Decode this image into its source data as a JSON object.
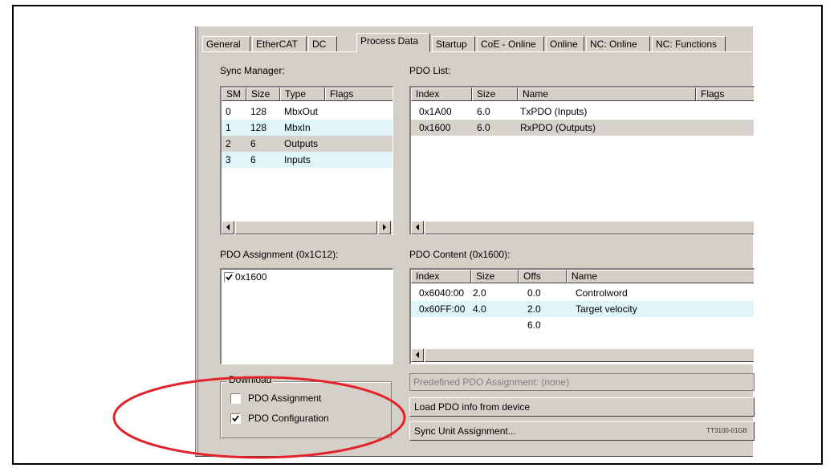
{
  "tabs": [
    "General",
    "EtherCAT",
    "DC",
    "Process Data",
    "Startup",
    "CoE - Online",
    "Online",
    "NC: Online",
    "NC: Functions"
  ],
  "active_tab": "Process Data",
  "sync_manager": {
    "label": "Sync Manager:",
    "columns": [
      "SM",
      "Size",
      "Type",
      "Flags"
    ],
    "rows": [
      {
        "sm": "0",
        "size": "128",
        "type": "MbxOut",
        "flags": ""
      },
      {
        "sm": "1",
        "size": "128",
        "type": "MbxIn",
        "flags": ""
      },
      {
        "sm": "2",
        "size": "6",
        "type": "Outputs",
        "flags": ""
      },
      {
        "sm": "3",
        "size": "6",
        "type": "Inputs",
        "flags": ""
      }
    ]
  },
  "pdo_list": {
    "label": "PDO List:",
    "columns": [
      "Index",
      "Size",
      "Name",
      "Flags"
    ],
    "rows": [
      {
        "index": "0x1A00",
        "size": "6.0",
        "name": "TxPDO (Inputs)",
        "flags": ""
      },
      {
        "index": "0x1600",
        "size": "6.0",
        "name": "RxPDO (Outputs)",
        "flags": ""
      }
    ]
  },
  "pdo_assignment": {
    "label": "PDO Assignment (0x1C12):",
    "items": [
      {
        "label": "0x1600",
        "checked": true
      }
    ]
  },
  "pdo_content": {
    "label": "PDO Content (0x1600):",
    "columns": [
      "Index",
      "Size",
      "Offs",
      "Name"
    ],
    "rows": [
      {
        "index": "0x6040:00",
        "size": "2.0",
        "offs": "0.0",
        "name": "Controlword"
      },
      {
        "index": "0x60FF:00",
        "size": "4.0",
        "offs": "2.0",
        "name": "Target velocity"
      },
      {
        "index": "",
        "size": "",
        "offs": "6.0",
        "name": ""
      }
    ]
  },
  "download": {
    "label": "Download",
    "pdo_assignment": {
      "label": "PDO Assignment",
      "checked": false
    },
    "pdo_configuration": {
      "label": "PDO Configuration",
      "checked": true
    }
  },
  "predefined": "Predefined PDO Assignment: (none)",
  "load_button": "Load PDO info from device",
  "sync_unit_button": "Sync Unit Assignment...",
  "figure_code": "TT3100-01GB",
  "colors": {
    "highlight_ellipse": "#e4222a",
    "row_highlight": "#dff5f8",
    "dialog_bg": "#d4d0c8"
  }
}
